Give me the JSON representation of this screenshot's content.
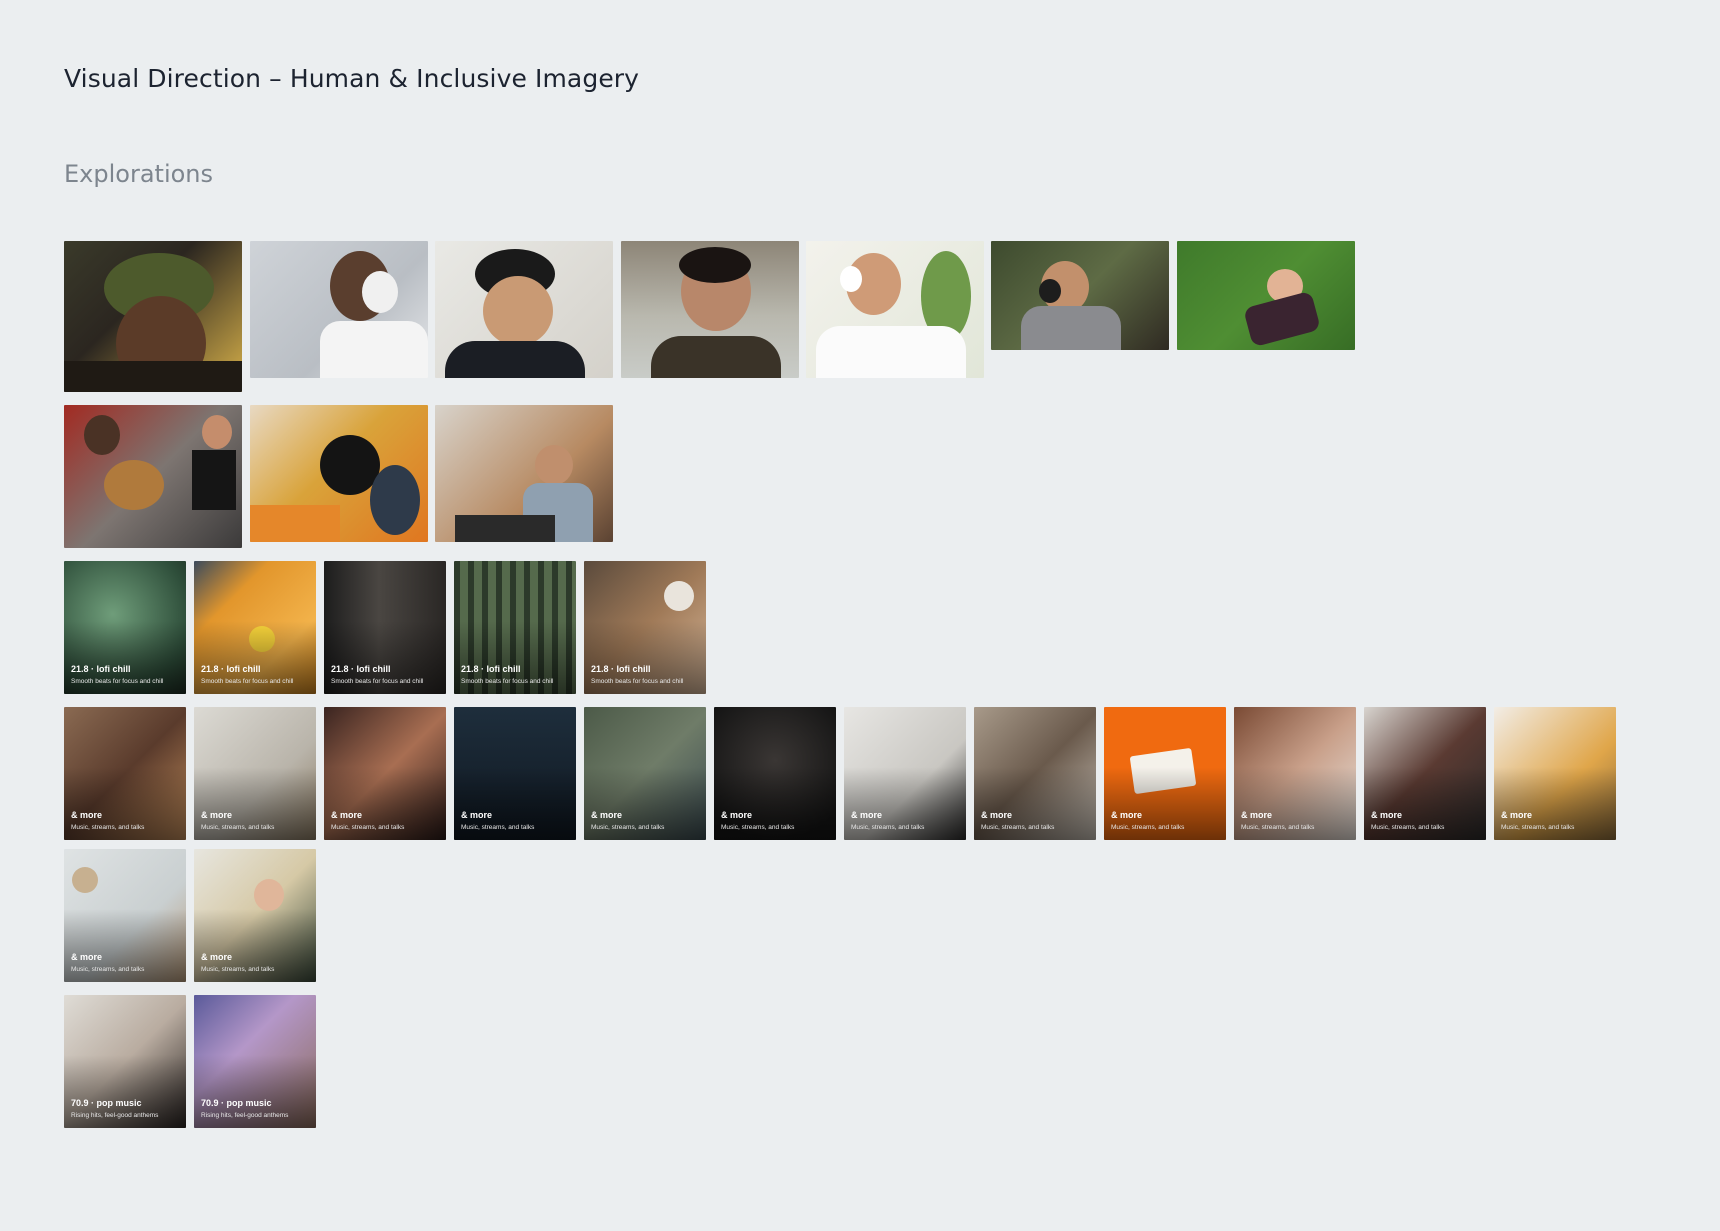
{
  "header": {
    "title": "Visual Direction – Human & Inclusive Imagery",
    "section": "Explorations"
  },
  "row1": [
    {
      "scene": "man in green beanie with earbuds"
    },
    {
      "scene": "man with white headphones looking at phone"
    },
    {
      "scene": "smiling person in black beanie with earbuds"
    },
    {
      "scene": "man at waterfront with earbud"
    },
    {
      "scene": "man with white headphones and phone by plant"
    },
    {
      "scene": "man with headphones sitting outdoors"
    },
    {
      "scene": "woman lying on grass with headphones"
    }
  ],
  "row2": [
    {
      "scene": "musicians playing guitar on street"
    },
    {
      "scene": "browsing vinyl records"
    },
    {
      "scene": "podcaster with headphones at microphone"
    }
  ],
  "lofi_cards": [
    {
      "title": "21.8 · lofi chill",
      "subtitle": "Smooth beats for focus and chill"
    },
    {
      "title": "21.8 · lofi chill",
      "subtitle": "Smooth beats for focus and chill"
    },
    {
      "title": "21.8 · lofi chill",
      "subtitle": "Smooth beats for focus and chill"
    },
    {
      "title": "21.8 · lofi chill",
      "subtitle": "Smooth beats for focus and chill"
    },
    {
      "title": "21.8 · lofi chill",
      "subtitle": "Smooth beats for focus and chill"
    }
  ],
  "more_cards": [
    {
      "title": "& more",
      "subtitle": "Music, streams, and talks"
    },
    {
      "title": "& more",
      "subtitle": "Music, streams, and talks"
    },
    {
      "title": "& more",
      "subtitle": "Music, streams, and talks"
    },
    {
      "title": "& more",
      "subtitle": "Music, streams, and talks"
    },
    {
      "title": "& more",
      "subtitle": "Music, streams, and talks"
    },
    {
      "title": "& more",
      "subtitle": "Music, streams, and talks"
    },
    {
      "title": "& more",
      "subtitle": "Music, streams, and talks"
    },
    {
      "title": "& more",
      "subtitle": "Music, streams, and talks"
    },
    {
      "title": "& more",
      "subtitle": "Music, streams, and talks"
    },
    {
      "title": "& more",
      "subtitle": "Music, streams, and talks"
    },
    {
      "title": "& more",
      "subtitle": "Music, streams, and talks"
    },
    {
      "title": "& more",
      "subtitle": "Music, streams, and talks"
    }
  ],
  "more_cards_row2": [
    {
      "title": "& more",
      "subtitle": "Music, streams, and talks"
    },
    {
      "title": "& more",
      "subtitle": "Music, streams, and talks"
    }
  ],
  "pop_cards": [
    {
      "title": "70.9 · pop music",
      "subtitle": "Rising hits, feel-good anthems"
    },
    {
      "title": "70.9 · pop music",
      "subtitle": "Rising hits, feel-good anthems"
    }
  ]
}
